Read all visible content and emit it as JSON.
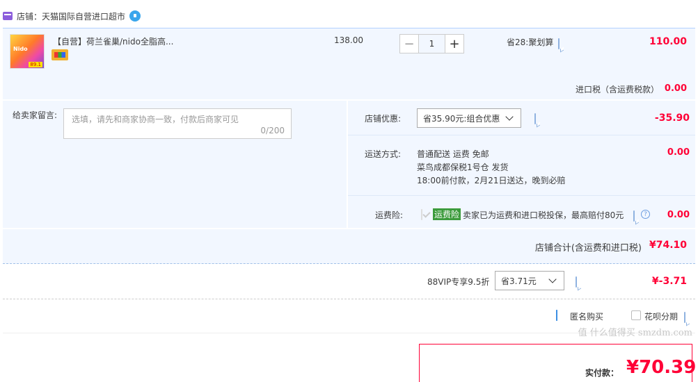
{
  "shop": {
    "label": "店铺：天猫国际自营进口超市"
  },
  "item": {
    "title": "【自营】荷兰雀巢/nido全脂高...",
    "thumb_brand": "Nido",
    "thumb_price": "89.1",
    "unit_price": "138.00",
    "quantity": "1",
    "promo": "省28:聚划算",
    "subtotal": "110.00",
    "import_tax_label": "进口税（含运费税款）",
    "import_tax_value": "0.00"
  },
  "message": {
    "label": "给卖家留言:",
    "placeholder": "选填，请先和商家协商一致，付款后商家可见",
    "counter": "0/200"
  },
  "shop_discount": {
    "label": "店铺优惠:",
    "selected": "省35.90元:组合优惠",
    "value": "-35.90"
  },
  "shipping": {
    "label": "运送方式:",
    "line1": "普通配送 运费 免邮",
    "line2": "菜鸟成都保税1号仓  发货",
    "line3": "18:00前付款，2月21日送达，晚到必赔",
    "value": "0.00"
  },
  "insurance": {
    "label": "运费险:",
    "badge": "运费险",
    "text": "卖家已为运费和进口税投保，最高赔付80元",
    "value": "0.00"
  },
  "shop_total": {
    "label": "店铺合计(含运费和进口税)",
    "value": "¥74.10"
  },
  "vip": {
    "label": "88VIP专享9.5折",
    "selected": "省3.71元",
    "value": "¥-3.71"
  },
  "options": {
    "anonymous": "匿名购买",
    "huabei": "花呗分期"
  },
  "pay": {
    "label": "实付款：",
    "value": "¥70.39"
  },
  "watermark": "值 什么值得买 smzdm.com",
  "colors": {
    "price_red": "#ff0036",
    "panel_bg": "#f2f7ff",
    "badge_green": "#3c9b3c",
    "link_blue": "#3b8fe3"
  }
}
